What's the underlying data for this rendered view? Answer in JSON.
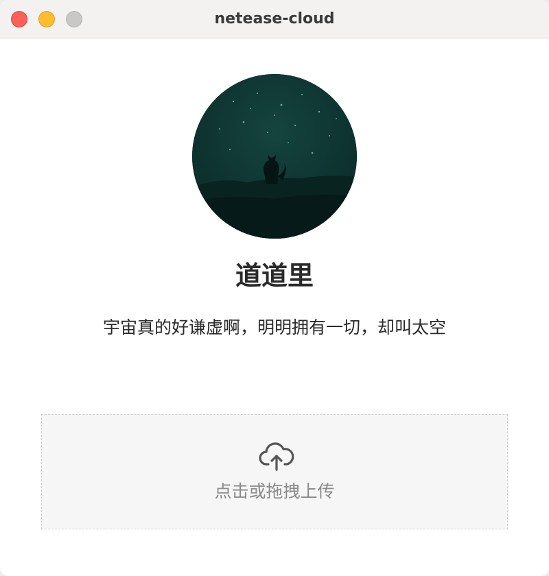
{
  "window": {
    "title": "netease-cloud"
  },
  "profile": {
    "avatar_icon": "starry-night-fox-avatar",
    "username": "道道里",
    "bio": "宇宙真的好谦虚啊，明明拥有一切，却叫太空"
  },
  "upload": {
    "icon": "cloud-upload-icon",
    "label": "点击或拖拽上传"
  },
  "colors": {
    "close": "#fe5f57",
    "minimize": "#febc2e",
    "maximize": "#c9c8c7",
    "avatar_bg": "#0d3330",
    "upload_bg": "#f6f6f6"
  }
}
